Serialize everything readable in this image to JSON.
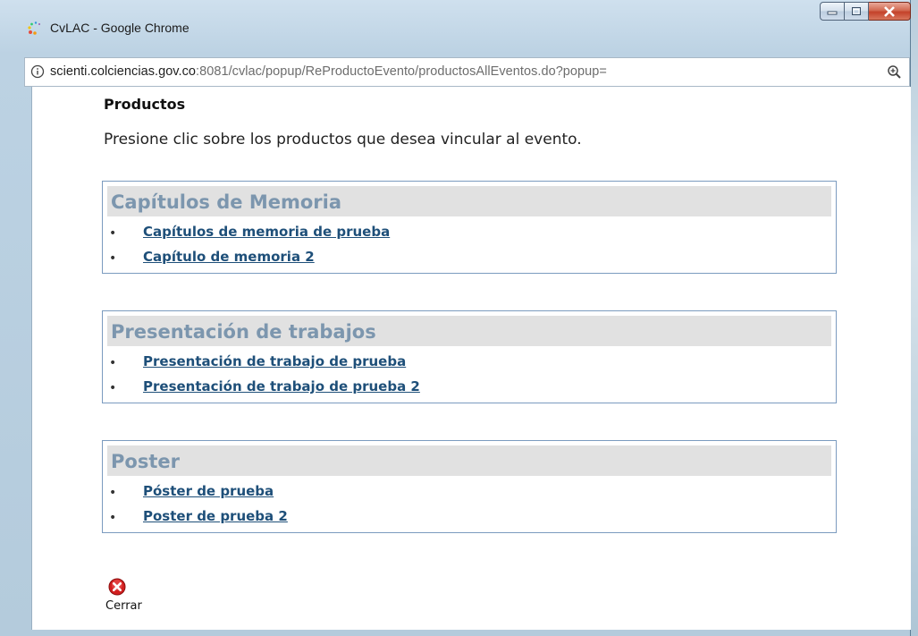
{
  "window": {
    "title": "CvLAC - Google Chrome"
  },
  "addressbar": {
    "url_host": "scienti.colciencias.gov.co",
    "url_rest": ":8081/cvlac/popup/ReProductoEvento/productosAllEventos.do?popup="
  },
  "page": {
    "heading": "Productos",
    "intro": "Presione clic sobre los productos que desea vincular al evento.",
    "groups": [
      {
        "title": "Capítulos de Memoria",
        "items": [
          "Capítulos de memoria de prueba",
          "Capítulo de memoria 2"
        ]
      },
      {
        "title": "Presentación de trabajos",
        "items": [
          "Presentación de trabajo de prueba",
          "Presentación de trabajo de prueba 2"
        ]
      },
      {
        "title": "Poster",
        "items": [
          "Póster de prueba",
          "Poster de prueba 2"
        ]
      }
    ],
    "close_label": "Cerrar"
  },
  "colors": {
    "group_title": "#7c96ae",
    "link": "#1e4f79",
    "group_border": "#7b9bbf"
  },
  "icons": {
    "app": "chrome-loading-icon",
    "info": "info-icon",
    "zoom": "zoom-icon",
    "close": "close-circle-icon"
  }
}
